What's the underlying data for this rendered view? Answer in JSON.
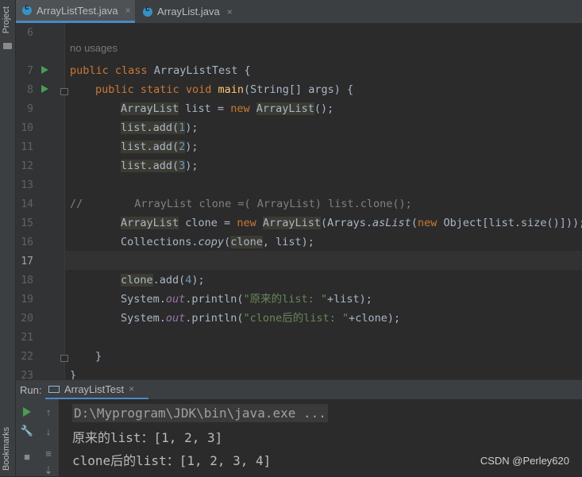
{
  "sidebar": {
    "project_label": "Project",
    "bookmarks_label": "Bookmarks"
  },
  "tabs": [
    {
      "label": "ArrayListTest.java",
      "close": "×"
    },
    {
      "label": "ArrayList.java",
      "close": "×"
    }
  ],
  "editor": {
    "line_numbers": [
      "6",
      "7",
      "8",
      "9",
      "10",
      "11",
      "12",
      "13",
      "14",
      "15",
      "16",
      "17",
      "18",
      "19",
      "20",
      "21",
      "22",
      "23"
    ],
    "usage_hint": "no usages",
    "tokens": {
      "l7": [
        "public",
        "class",
        "ArrayListTest {"
      ],
      "l8": [
        "public",
        "static",
        "void",
        "main",
        "(String[] args) {"
      ],
      "l9": [
        "ArrayList",
        " list = ",
        "new",
        " ",
        "ArrayList",
        "();"
      ],
      "l10": [
        "list",
        ".add(",
        "1",
        ");"
      ],
      "l11": [
        "list",
        ".add(",
        "2",
        ");"
      ],
      "l12": [
        "list",
        ".add(",
        "3",
        ");"
      ],
      "l14": "//        ArrayList clone =( ArrayList) list.clone();",
      "l15": [
        "ArrayList",
        " clone = ",
        "new",
        " ",
        "ArrayList",
        "(Arrays.",
        "asList",
        "(",
        "new",
        " Object[list.size()]));"
      ],
      "l16": [
        "Collections.",
        "copy",
        "(",
        "clone",
        ", list);"
      ],
      "l18": [
        "clone",
        ".add(",
        "4",
        ");"
      ],
      "l19": [
        "System.",
        "out",
        ".println(",
        "\"原来的list: \"",
        "+list);"
      ],
      "l20": [
        "System.",
        "out",
        ".println(",
        "\"clone后的list: \"",
        "+clone);"
      ],
      "l22": "}",
      "l23": "}"
    }
  },
  "run_panel": {
    "label": "Run:",
    "tab_label": "ArrayListTest",
    "tab_close": "×",
    "console": [
      "D:\\Myprogram\\JDK\\bin\\java.exe ...",
      "原来的list：[1, 2, 3]",
      "clone后的list：[1, 2, 3, 4]"
    ]
  },
  "watermark": "CSDN @Perley620",
  "colors": {
    "keyword": "#cc7832",
    "function": "#ffc66d",
    "number": "#6897bb",
    "string": "#6a8759",
    "accent": "#4a88c7"
  }
}
